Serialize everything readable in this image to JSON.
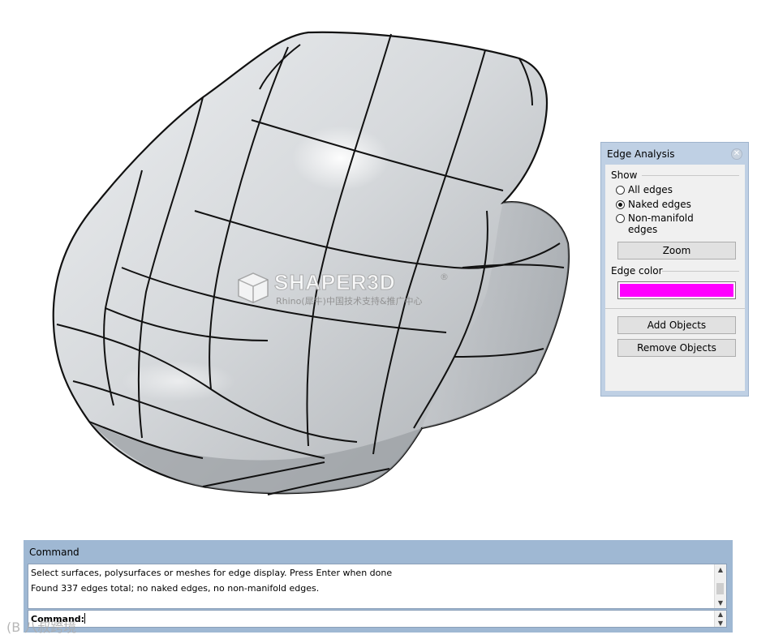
{
  "viewport": {
    "watermark_logo": "SHAPER3D",
    "watermark_registered": "®",
    "watermark_subtitle": "Rhino(犀牛)中国技术支持&推广中心"
  },
  "edge_panel": {
    "title": "Edge Analysis",
    "close_icon": "close-icon",
    "show_label": "Show",
    "options": [
      {
        "label": "All edges",
        "selected": false
      },
      {
        "label": "Naked edges",
        "selected": true
      },
      {
        "label": "Non-manifold",
        "label2": "edges",
        "selected": false
      }
    ],
    "zoom_label": "Zoom",
    "edge_color_label": "Edge color",
    "edge_color": "#ff00ff",
    "add_objects_label": "Add Objects",
    "remove_objects_label": "Remove Objects"
  },
  "command": {
    "title": "Command",
    "history": [
      "Select surfaces, polysurfaces or meshes for edge display. Press Enter when done",
      "Found 337 edges total; no naked edges, no non-manifold edges."
    ],
    "prompt": "Command:",
    "scroll_up_icon": "chevron-up-icon",
    "scroll_down_icon": "chevron-down-icon"
  },
  "corner_watermark": "(B 八叔跨境"
}
